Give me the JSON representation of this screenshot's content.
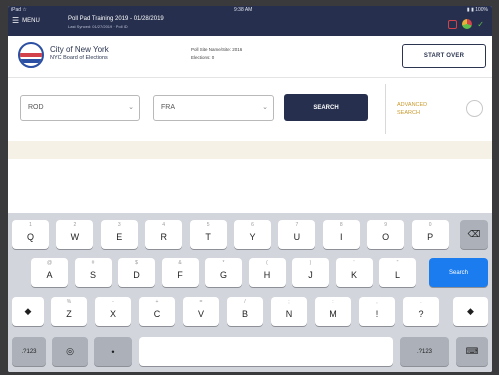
{
  "status_bar": {
    "carrier": "iPad ☆",
    "time": "9:38 AM",
    "battery": "▮ ▮ 100%"
  },
  "title_bar": {
    "menu_label": "MENU",
    "title": "Poll Pad Training 2019 - 01/28/2019",
    "subtitle": "Last Synced: 01/27/2019 · Poll ID"
  },
  "header": {
    "org_name": "City of New York",
    "org_sub": "NYC Board of Elections",
    "site_line1": "Poll Site Name/Site:  2016",
    "site_line2": "Elections:  0",
    "start_over_label": "START OVER"
  },
  "search_form": {
    "field1_value": "ROD",
    "field2_value": "FRA",
    "search_label": "SEARCH",
    "advanced_label_line1": "ADVANCED",
    "advanced_label_line2": "SEARCH"
  },
  "keyboard": {
    "row1": [
      {
        "main": "Q",
        "alt": "1"
      },
      {
        "main": "W",
        "alt": "2"
      },
      {
        "main": "E",
        "alt": "3"
      },
      {
        "main": "R",
        "alt": "4"
      },
      {
        "main": "T",
        "alt": "5"
      },
      {
        "main": "Y",
        "alt": "6"
      },
      {
        "main": "U",
        "alt": "7"
      },
      {
        "main": "I",
        "alt": "8"
      },
      {
        "main": "O",
        "alt": "9"
      },
      {
        "main": "P",
        "alt": "0"
      }
    ],
    "row2": [
      {
        "main": "A",
        "alt": "@"
      },
      {
        "main": "S",
        "alt": "#"
      },
      {
        "main": "D",
        "alt": "$"
      },
      {
        "main": "F",
        "alt": "&"
      },
      {
        "main": "G",
        "alt": "*"
      },
      {
        "main": "H",
        "alt": "("
      },
      {
        "main": "J",
        "alt": ")"
      },
      {
        "main": "K",
        "alt": "'"
      },
      {
        "main": "L",
        "alt": "\""
      }
    ],
    "row3": [
      {
        "main": "Z",
        "alt": "%"
      },
      {
        "main": "X",
        "alt": "-"
      },
      {
        "main": "C",
        "alt": "+"
      },
      {
        "main": "V",
        "alt": "="
      },
      {
        "main": "B",
        "alt": "/"
      },
      {
        "main": "N",
        "alt": ";"
      },
      {
        "main": "M",
        "alt": ":"
      },
      {
        "main": "!",
        "alt": ","
      },
      {
        "main": "?",
        "alt": "."
      }
    ],
    "backspace_icon": "⌫",
    "search_key_label": "Search",
    "shift_icon": "◆",
    "numbers_label": ".?123",
    "globe_icon": "◎",
    "mic_icon": "•",
    "hide_keyboard_icon": "⌨"
  }
}
